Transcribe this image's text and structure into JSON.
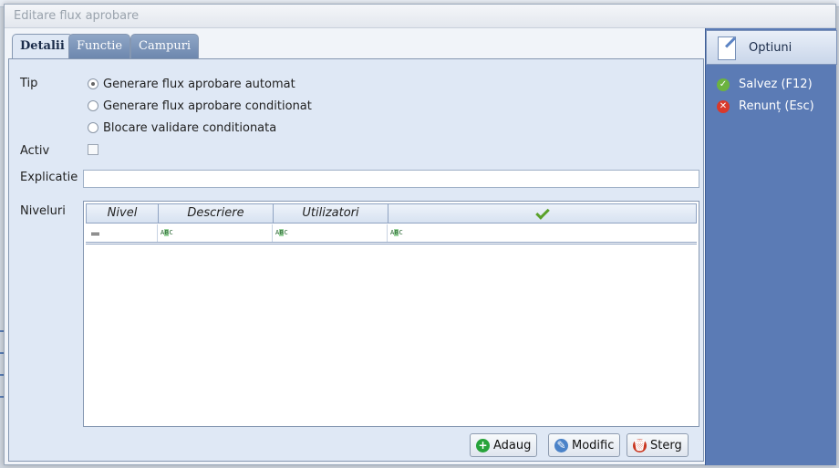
{
  "dialog": {
    "title": "Editare flux aprobare"
  },
  "tabs": [
    {
      "label": "Detalii"
    },
    {
      "label": "Functie"
    },
    {
      "label": "Campuri"
    }
  ],
  "form": {
    "tip_label": "Tip",
    "tip_options": [
      {
        "label": "Generare flux aprobare automat",
        "selected": true
      },
      {
        "label": "Generare flux aprobare conditionat",
        "selected": false
      },
      {
        "label": "Blocare validare conditionata",
        "selected": false
      }
    ],
    "activ_label": "Activ",
    "activ_checked": false,
    "explicatie_label": "Explicatie",
    "explicatie_value": "",
    "niveluri_label": "Niveluri"
  },
  "grid": {
    "columns": [
      "Nivel",
      "Descriere",
      "Utilizatori"
    ],
    "check_column_icon": "checkmark-icon",
    "filter_icons": [
      "equals-icon",
      "text-filter-icon",
      "text-filter-icon",
      "text-filter-icon"
    ],
    "filter_icon_text": "ABC",
    "rows": []
  },
  "buttons": {
    "add": "Adaug",
    "edit": "Modific",
    "delete": "Sterg"
  },
  "options_panel": {
    "title": "Optiuni",
    "save": "Salvez (F12)",
    "cancel": "Renunț (Esc)"
  },
  "colors": {
    "accent": "#5b7bb5",
    "save_green": "#6cb33f",
    "cancel_red": "#d9392b",
    "add_green": "#27a33a",
    "delete_red": "#c9361f"
  }
}
